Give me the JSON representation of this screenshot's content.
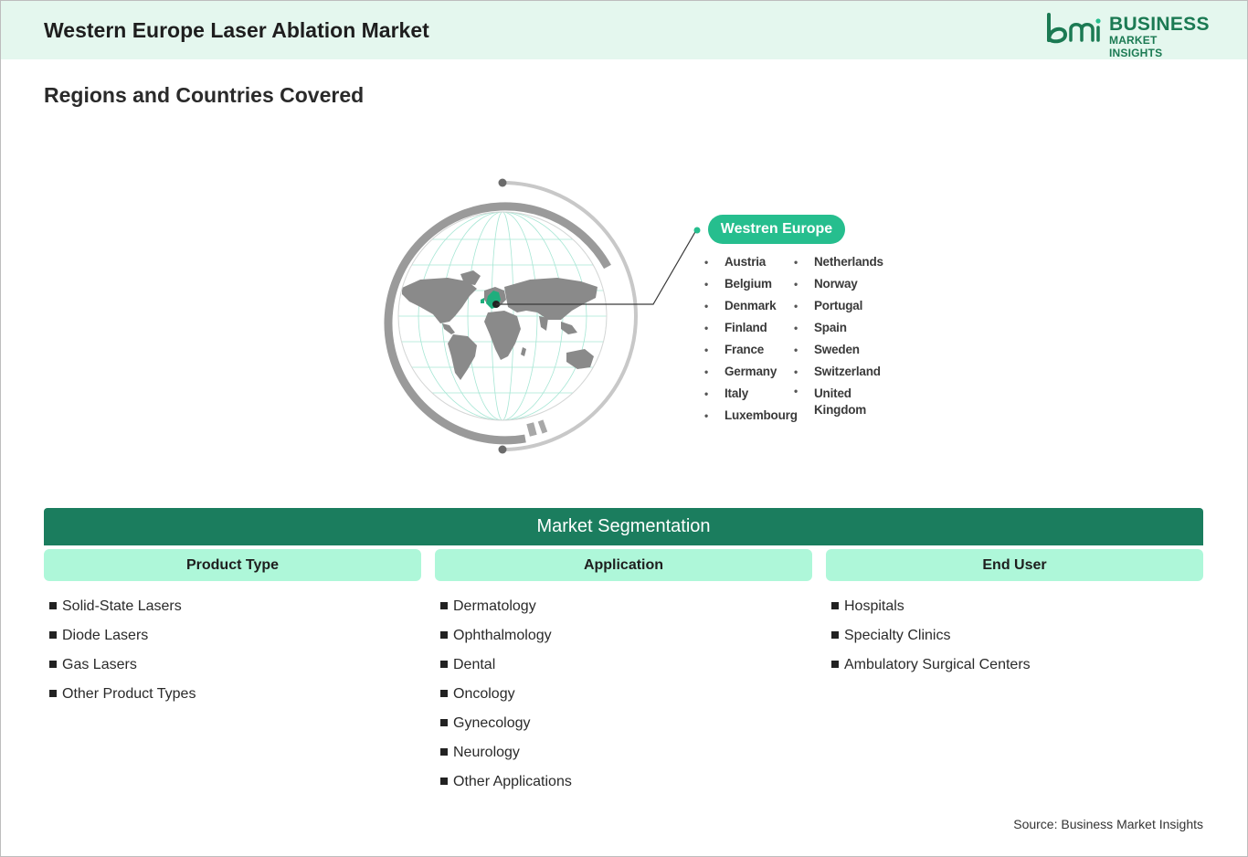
{
  "header": {
    "title": "Western Europe Laser Ablation Market",
    "logo": {
      "mark": "bmi",
      "line1": "BUSINESS",
      "line2": "MARKET INSIGHTS"
    }
  },
  "subtitle": "Regions and Countries Covered",
  "region": {
    "name": "Westren Europe",
    "countries_col1": [
      "Austria",
      "Belgium",
      "Denmark",
      "Finland",
      "France",
      "Germany",
      "Italy",
      "Luxembourg"
    ],
    "countries_col2": [
      "Netherlands",
      "Norway",
      "Portugal",
      "Spain",
      "Sweden",
      "Switzerland",
      "United Kingdom"
    ]
  },
  "segmentation": {
    "title": "Market Segmentation",
    "columns": [
      {
        "heading": "Product Type",
        "items": [
          "Solid-State Lasers",
          "Diode Lasers",
          "Gas Lasers",
          "Other Product Types"
        ]
      },
      {
        "heading": "Application",
        "items": [
          "Dermatology",
          "Ophthalmology",
          "Dental",
          "Oncology",
          "Gynecology",
          "Neurology",
          "Other Applications"
        ]
      },
      {
        "heading": "End User",
        "items": [
          "Hospitals",
          "Specialty Clinics",
          "Ambulatory Surgical Centers"
        ]
      }
    ]
  },
  "source": "Source: Business Market Insights",
  "colors": {
    "header_bg": "#e4f7ee",
    "brand_green": "#1b7a53",
    "segment_bar": "#1b7d5e",
    "segment_head": "#aef7d9",
    "region_pill": "#26be8e",
    "highlight": "#1fae7d"
  }
}
